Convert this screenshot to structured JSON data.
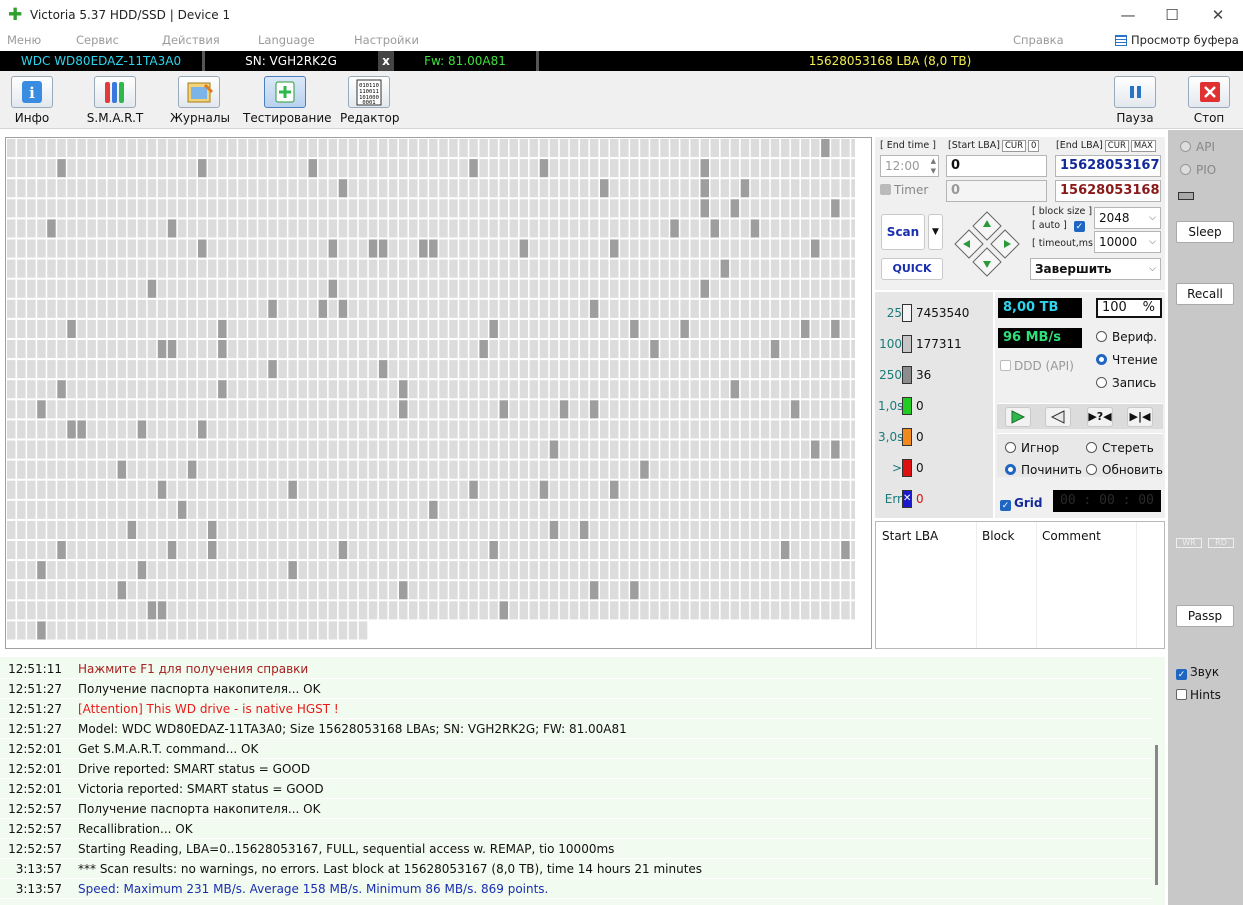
{
  "window": {
    "title": "Victoria 5.37 HDD/SSD | Device 1",
    "min": "—",
    "max": "☐",
    "close": "✕"
  },
  "menu": {
    "items": [
      "Меню",
      "Сервис",
      "Действия",
      "Language",
      "Настройки"
    ],
    "help": "Справка",
    "buffer": "Просмотр буфера"
  },
  "device": {
    "model": "WDC WD80EDAZ-11TA3A0",
    "serial": "SN: VGH2RK2G",
    "close_mark": "x",
    "firmware": "Fw: 81.00A81",
    "lba": "15628053168 LBA (8,0 TB)"
  },
  "toolbar": {
    "info": "Инфо",
    "smart": "S.M.A.R.T",
    "logs": "Журналы",
    "testing": "Тестирование",
    "editor": "Редактор",
    "pause": "Пауза",
    "stop": "Стоп"
  },
  "test": {
    "end_time_label": "[ End time ]",
    "start_lba_label": "[Start LBA]",
    "end_lba_label": "[End LBA]",
    "cur_tag": "CUR",
    "cur_value": "0",
    "max_tag": "MAX",
    "end_time": "12:00",
    "timer_label": "Timer",
    "start_lba": "0",
    "start_lba2": "0",
    "end_lba": "15628053167",
    "end_lba2": "15628053168",
    "scan_btn": "Scan",
    "quick_btn": "QUICK",
    "block_size_label": "[ block size ]",
    "auto_label": "[ auto ]",
    "timeout_label": "[ timeout,ms ]",
    "block_size": "2048",
    "timeout": "10000",
    "finish_option": "Завершить"
  },
  "blocks": [
    {
      "label": "25",
      "value": "7453540",
      "color": "#f4f4f4"
    },
    {
      "label": "100",
      "value": "177311",
      "color": "#c6c6c6"
    },
    {
      "label": "250",
      "value": "36",
      "color": "#8c8c8c"
    },
    {
      "label": "1,0s",
      "value": "0",
      "color": "#22cc22"
    },
    {
      "label": "3,0s",
      "value": "0",
      "color": "#f08a1e"
    },
    {
      "label": ">",
      "value": "0",
      "color": "#dd1111"
    },
    {
      "label": "Err",
      "value": "0",
      "color": "#1a1acc"
    }
  ],
  "stats": {
    "size": "8,00 TB",
    "percent": "100",
    "percent_sign": "%",
    "speed": "96 MB/s",
    "ddd": "DDD (API)"
  },
  "modes": {
    "verify": "Вериф.",
    "read": "Чтение",
    "write": "Запись",
    "selected": "read"
  },
  "actions": {
    "ignore": "Игнор",
    "erase": "Стереть",
    "repair": "Починить",
    "refresh": "Обновить",
    "selected": "repair"
  },
  "grid": {
    "label": "Grid",
    "timer": "00 : 00 : 00"
  },
  "badlist": {
    "columns": [
      "Start LBA",
      "Block",
      "Comment"
    ]
  },
  "side": {
    "api": "API",
    "pio": "PIO",
    "sleep": "Sleep",
    "recall": "Recall",
    "wr": "WR",
    "rd": "RD",
    "passp": "Passp",
    "sound": "Звук",
    "hints": "Hints"
  },
  "log": [
    {
      "time": "12:51:11",
      "msg": "Нажмите F1 для получения справки",
      "color": "#a52020"
    },
    {
      "time": "12:51:27",
      "msg": "Получение паспорта накопителя... OK",
      "color": "#111111"
    },
    {
      "time": "12:51:27",
      "msg": "[Attention] This WD drive - is native HGST !",
      "color": "#e81a1a"
    },
    {
      "time": "12:51:27",
      "msg": "Model: WDC WD80EDAZ-11TA3A0; Size 15628053168 LBAs; SN: VGH2RK2G; FW: 81.00A81",
      "color": "#111111"
    },
    {
      "time": "12:52:01",
      "msg": "Get S.M.A.R.T. command... OK",
      "color": "#111111"
    },
    {
      "time": "12:52:01",
      "msg": "Drive reported: SMART status = GOOD",
      "color": "#111111"
    },
    {
      "time": "12:52:01",
      "msg": "Victoria reported: SMART status = GOOD",
      "color": "#111111"
    },
    {
      "time": "12:52:57",
      "msg": "Получение паспорта накопителя... OK",
      "color": "#111111"
    },
    {
      "time": "12:52:57",
      "msg": "Recallibration... OK",
      "color": "#111111"
    },
    {
      "time": "12:52:57",
      "msg": "Starting Reading, LBA=0..15628053167, FULL, sequential access w. REMAP, tio 10000ms",
      "color": "#111111"
    },
    {
      "time": "3:13:57",
      "msg": "*** Scan results: no warnings, no errors. Last block at 15628053167 (8,0 TB), time 14 hours 21 minutes",
      "color": "#111111"
    },
    {
      "time": "3:13:57",
      "msg": "Speed: Maximum 231 MB/s. Average 158 MB/s. Minimum 86 MB/s. 869 points.",
      "color": "#1a2fb0"
    }
  ]
}
